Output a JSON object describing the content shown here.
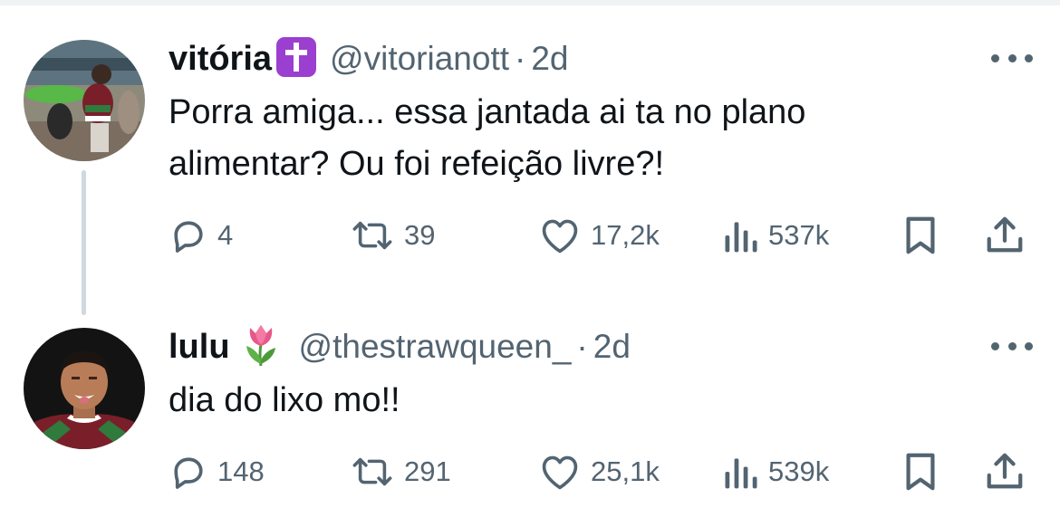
{
  "tweets": [
    {
      "name": "vitória",
      "name_emoji": "latin-cross-emoji",
      "handle": "@vitorianott",
      "separator": "·",
      "time": "2d",
      "text_line1": "Porra amiga... essa jantada ai ta no plano",
      "text_line2": "alimentar? Ou foi refeição livre?!",
      "replies": "4",
      "retweets": "39",
      "likes": "17,2k",
      "views": "537k"
    },
    {
      "name": "lulu",
      "name_emoji": "tulip-emoji",
      "handle": "@thestrawqueen_",
      "separator": "·",
      "time": "2d",
      "text_line1": "dia do lixo mo!!",
      "replies": "148",
      "retweets": "291",
      "likes": "25,1k",
      "views": "539k"
    }
  ],
  "colors": {
    "text": "#0f1419",
    "secondary": "#536471",
    "thread_line": "#cfd9de",
    "cross_badge": "#9b3fd0"
  }
}
